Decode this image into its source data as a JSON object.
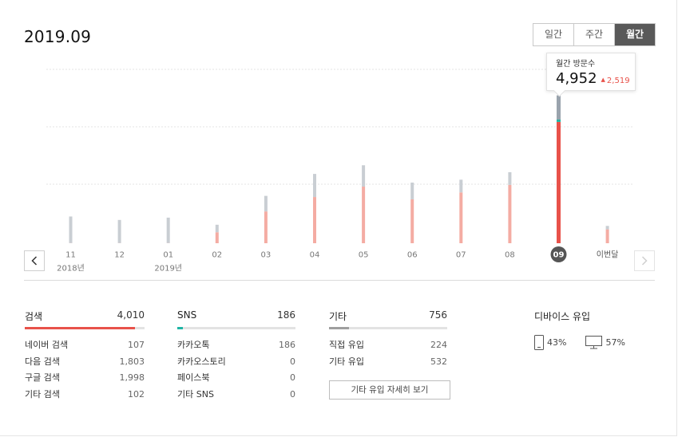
{
  "period_title": "2019.09",
  "range_toggle": [
    {
      "label": "일간",
      "active": false
    },
    {
      "label": "주간",
      "active": false
    },
    {
      "label": "월간",
      "active": true
    }
  ],
  "tooltip": {
    "label": "월간 방문수",
    "value": "4,952",
    "delta": "2,519"
  },
  "colors": {
    "accent": "#e8524a",
    "accent_light": "#f4aca3",
    "gray_bar": "#c9ced3",
    "sns_teal": "#1fb5a5",
    "selected_gray": "#9aa3ad",
    "other_gray": "#9e9e9e"
  },
  "chart_data": {
    "type": "bar",
    "stacked": true,
    "categories": [
      "11",
      "12",
      "01",
      "02",
      "03",
      "04",
      "05",
      "06",
      "07",
      "08",
      "09",
      "이번달"
    ],
    "year_labels": [
      {
        "category": "11",
        "label": "2018년"
      },
      {
        "category": "01",
        "label": "2019년"
      }
    ],
    "series": [
      {
        "values": [
          30,
          30,
          30,
          1900,
          5500,
          8000,
          9800,
          7600,
          8800,
          10100,
          21000,
          2400
        ]
      },
      {
        "values": [
          0,
          0,
          0,
          0,
          0,
          0,
          0,
          0,
          0,
          0,
          400,
          0
        ]
      },
      {
        "values": [
          4600,
          4000,
          4400,
          1300,
          2700,
          4000,
          3700,
          2900,
          2200,
          2200,
          4200,
          600
        ]
      }
    ],
    "selected_index": 10,
    "ylim": [
      0,
      33000
    ],
    "grid": true
  },
  "sources": {
    "search": {
      "title": "검색",
      "total": "4,010",
      "ratio": 0.92,
      "rows": [
        {
          "k": "네이버 검색",
          "v": "107"
        },
        {
          "k": "다음 검색",
          "v": "1,803"
        },
        {
          "k": "구글 검색",
          "v": "1,998"
        },
        {
          "k": "기타 검색",
          "v": "102"
        }
      ]
    },
    "sns": {
      "title": "SNS",
      "total": "186",
      "ratio": 0.05,
      "rows": [
        {
          "k": "카카오톡",
          "v": "186"
        },
        {
          "k": "카카오스토리",
          "v": "0"
        },
        {
          "k": "페이스북",
          "v": "0"
        },
        {
          "k": "기타 SNS",
          "v": "0"
        }
      ]
    },
    "other": {
      "title": "기타",
      "total": "756",
      "ratio": 0.17,
      "rows": [
        {
          "k": "직접 유입",
          "v": "224"
        },
        {
          "k": "기타 유입",
          "v": "532"
        }
      ],
      "more_label": "기타 유입 자세히 보기"
    },
    "device": {
      "title": "디바이스 유입",
      "mobile_pct": "43%",
      "pc_pct": "57%"
    }
  }
}
